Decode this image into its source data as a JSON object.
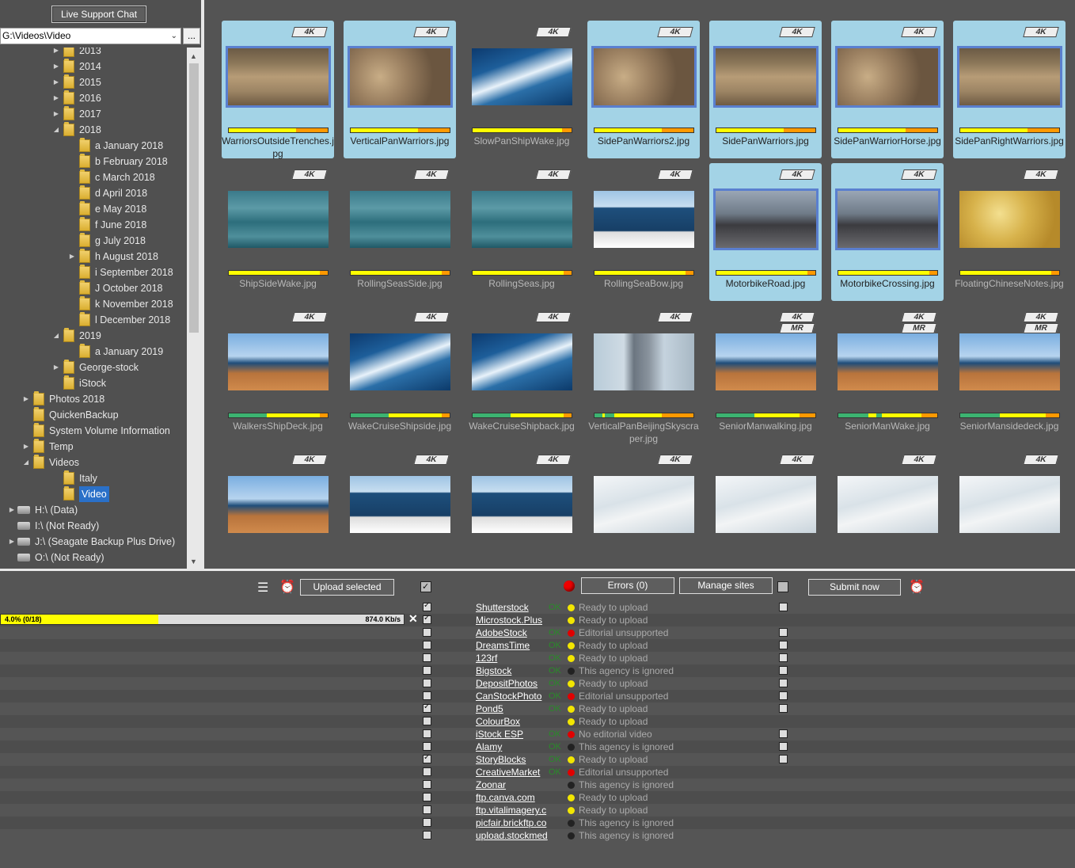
{
  "top": {
    "chat_label": "Live Support Chat",
    "path_value": "G:\\Videos\\Video",
    "browse_label": "..."
  },
  "tree": [
    {
      "label": "2013",
      "depth": 3,
      "arrow": "right",
      "icon": "folder"
    },
    {
      "label": "2014",
      "depth": 3,
      "arrow": "right",
      "icon": "folder"
    },
    {
      "label": "2015",
      "depth": 3,
      "arrow": "right",
      "icon": "folder"
    },
    {
      "label": "2016",
      "depth": 3,
      "arrow": "right",
      "icon": "folder"
    },
    {
      "label": "2017",
      "depth": 3,
      "arrow": "right",
      "icon": "folder"
    },
    {
      "label": "2018",
      "depth": 3,
      "arrow": "down",
      "icon": "folder"
    },
    {
      "label": "a January 2018",
      "depth": 4,
      "arrow": "",
      "icon": "folder"
    },
    {
      "label": "b February 2018",
      "depth": 4,
      "arrow": "",
      "icon": "folder"
    },
    {
      "label": "c March 2018",
      "depth": 4,
      "arrow": "",
      "icon": "folder"
    },
    {
      "label": "d April 2018",
      "depth": 4,
      "arrow": "",
      "icon": "folder"
    },
    {
      "label": "e May 2018",
      "depth": 4,
      "arrow": "",
      "icon": "folder"
    },
    {
      "label": "f June 2018",
      "depth": 4,
      "arrow": "",
      "icon": "folder"
    },
    {
      "label": "g July 2018",
      "depth": 4,
      "arrow": "",
      "icon": "folder"
    },
    {
      "label": "h August 2018",
      "depth": 4,
      "arrow": "right",
      "icon": "folder"
    },
    {
      "label": "i September 2018",
      "depth": 4,
      "arrow": "",
      "icon": "folder"
    },
    {
      "label": "J October 2018",
      "depth": 4,
      "arrow": "",
      "icon": "folder"
    },
    {
      "label": "k November 2018",
      "depth": 4,
      "arrow": "",
      "icon": "folder"
    },
    {
      "label": "l December 2018",
      "depth": 4,
      "arrow": "",
      "icon": "folder"
    },
    {
      "label": "2019",
      "depth": 3,
      "arrow": "down",
      "icon": "folder"
    },
    {
      "label": "a January 2019",
      "depth": 4,
      "arrow": "",
      "icon": "folder"
    },
    {
      "label": "George-stock",
      "depth": 3,
      "arrow": "right",
      "icon": "folder"
    },
    {
      "label": "iStock",
      "depth": 3,
      "arrow": "",
      "icon": "folder"
    },
    {
      "label": "Photos 2018",
      "depth": 2,
      "arrow": "right",
      "icon": "folder"
    },
    {
      "label": "QuickenBackup",
      "depth": 2,
      "arrow": "",
      "icon": "folder"
    },
    {
      "label": "System Volume Information",
      "depth": 2,
      "arrow": "",
      "icon": "folder"
    },
    {
      "label": "Temp",
      "depth": 2,
      "arrow": "right",
      "icon": "folder"
    },
    {
      "label": "Videos",
      "depth": 2,
      "arrow": "down",
      "icon": "folder"
    },
    {
      "label": "Italy",
      "depth": 3,
      "arrow": "",
      "icon": "folder"
    },
    {
      "label": "Video",
      "depth": 3,
      "arrow": "",
      "icon": "folder",
      "selected": true
    },
    {
      "label": "H:\\ (Data)",
      "depth": 1,
      "arrow": "right",
      "icon": "drive"
    },
    {
      "label": "I:\\ (Not Ready)",
      "depth": 1,
      "arrow": "",
      "icon": "drive"
    },
    {
      "label": "J:\\ (Seagate Backup Plus Drive)",
      "depth": 1,
      "arrow": "right",
      "icon": "drive"
    },
    {
      "label": "O:\\ (Not Ready)",
      "depth": 1,
      "arrow": "",
      "icon": "drive"
    }
  ],
  "thumbnails": [
    {
      "name": "WarriorsOutsideTrenches.jpg",
      "selected": true,
      "badges": [
        "4K"
      ],
      "scene": "warriors1",
      "bar": [
        [
          "#ffff00",
          68
        ],
        [
          "#ff9900",
          32
        ]
      ]
    },
    {
      "name": "VerticalPanWarriors.jpg",
      "selected": true,
      "badges": [
        "4K"
      ],
      "scene": "warriors2",
      "bar": [
        [
          "#ffff00",
          68
        ],
        [
          "#ff9900",
          32
        ]
      ]
    },
    {
      "name": "SlowPanShipWake.jpg",
      "selected": false,
      "badges": [
        "4K"
      ],
      "scene": "wake",
      "bar": [
        [
          "#ffff00",
          90
        ],
        [
          "#ff9900",
          10
        ]
      ]
    },
    {
      "name": "SidePanWarriors2.jpg",
      "selected": true,
      "badges": [
        "4K"
      ],
      "scene": "warriors2",
      "bar": [
        [
          "#ffff00",
          68
        ],
        [
          "#ff9900",
          32
        ]
      ]
    },
    {
      "name": "SidePanWarriors.jpg",
      "selected": true,
      "badges": [
        "4K"
      ],
      "scene": "warriors1",
      "bar": [
        [
          "#ffff00",
          68
        ],
        [
          "#ff9900",
          32
        ]
      ]
    },
    {
      "name": "SidePanWarriorHorse.jpg",
      "selected": true,
      "badges": [
        "4K"
      ],
      "scene": "warriors2",
      "bar": [
        [
          "#ffff00",
          68
        ],
        [
          "#ff9900",
          32
        ]
      ]
    },
    {
      "name": "SidePanRightWarriors.jpg",
      "selected": true,
      "badges": [
        "4K"
      ],
      "scene": "warriors1",
      "bar": [
        [
          "#ffff00",
          68
        ],
        [
          "#ff9900",
          32
        ]
      ]
    },
    {
      "name": "ShipSideWake.jpg",
      "selected": false,
      "badges": [
        "4K"
      ],
      "scene": "sea",
      "bar": [
        [
          "#ffff00",
          92
        ],
        [
          "#ff9900",
          8
        ]
      ]
    },
    {
      "name": "RollingSeasSide.jpg",
      "selected": false,
      "badges": [
        "4K"
      ],
      "scene": "sea",
      "bar": [
        [
          "#ffff00",
          92
        ],
        [
          "#ff9900",
          8
        ]
      ]
    },
    {
      "name": "RollingSeas.jpg",
      "selected": false,
      "badges": [
        "4K"
      ],
      "scene": "sea",
      "bar": [
        [
          "#ffff00",
          92
        ],
        [
          "#ff9900",
          8
        ]
      ]
    },
    {
      "name": "RollingSeaBow.jpg",
      "selected": false,
      "badges": [
        "4K"
      ],
      "scene": "bow",
      "bar": [
        [
          "#ffff00",
          92
        ],
        [
          "#ff9900",
          8
        ]
      ]
    },
    {
      "name": "MotorbikeRoad.jpg",
      "selected": true,
      "badges": [
        "4K"
      ],
      "scene": "street",
      "bar": [
        [
          "#ffff00",
          92
        ],
        [
          "#ff9900",
          8
        ]
      ]
    },
    {
      "name": "MotorbikeCrossing.jpg",
      "selected": true,
      "badges": [
        "4K"
      ],
      "scene": "street",
      "bar": [
        [
          "#ffff00",
          92
        ],
        [
          "#ff9900",
          8
        ]
      ]
    },
    {
      "name": "FloatingChineseNotes.jpg",
      "selected": false,
      "badges": [
        "4K"
      ],
      "scene": "notes",
      "bar": [
        [
          "#ffff00",
          92
        ],
        [
          "#ff9900",
          8
        ]
      ]
    },
    {
      "name": "WalkersShipDeck.jpg",
      "selected": false,
      "badges": [
        "4K"
      ],
      "scene": "deck",
      "bar": [
        [
          "#3cb371",
          38
        ],
        [
          "#ffff00",
          54
        ],
        [
          "#ff9900",
          8
        ]
      ]
    },
    {
      "name": "WakeCruiseShipside.jpg",
      "selected": false,
      "badges": [
        "4K"
      ],
      "scene": "wake",
      "bar": [
        [
          "#3cb371",
          38
        ],
        [
          "#ffff00",
          54
        ],
        [
          "#ff9900",
          8
        ]
      ]
    },
    {
      "name": "WakeCruiseShipback.jpg",
      "selected": false,
      "badges": [
        "4K"
      ],
      "scene": "wake",
      "bar": [
        [
          "#3cb371",
          38
        ],
        [
          "#ffff00",
          54
        ],
        [
          "#ff9900",
          8
        ]
      ]
    },
    {
      "name": "VerticalPanBeijingSkyscraper.jpg",
      "selected": false,
      "badges": [
        "4K"
      ],
      "scene": "sky",
      "bar": [
        [
          "#3cb371",
          8
        ],
        [
          "#ffff00",
          2
        ],
        [
          "#3cb371",
          10
        ],
        [
          "#ffff00",
          48
        ],
        [
          "#ff9900",
          32
        ]
      ]
    },
    {
      "name": "SeniorManwalking.jpg",
      "selected": false,
      "badges": [
        "4K",
        "MR"
      ],
      "scene": "deck",
      "bar": [
        [
          "#3cb371",
          38
        ],
        [
          "#ffff00",
          46
        ],
        [
          "#ff9900",
          16
        ]
      ]
    },
    {
      "name": "SeniorManWake.jpg",
      "selected": false,
      "badges": [
        "4K",
        "MR"
      ],
      "scene": "deck",
      "bar": [
        [
          "#3cb371",
          30
        ],
        [
          "#ffff00",
          8
        ],
        [
          "#3cb371",
          6
        ],
        [
          "#ffff00",
          40
        ],
        [
          "#ff9900",
          16
        ]
      ]
    },
    {
      "name": "SeniorMansidedeck.jpg",
      "selected": false,
      "badges": [
        "4K",
        "MR"
      ],
      "scene": "deck",
      "bar": [
        [
          "#3cb371",
          40
        ],
        [
          "#ffff00",
          46
        ],
        [
          "#ff9900",
          14
        ]
      ]
    },
    {
      "name": "",
      "selected": false,
      "badges": [
        "4K"
      ],
      "scene": "deck",
      "bar": null
    },
    {
      "name": "",
      "selected": false,
      "badges": [
        "4K"
      ],
      "scene": "bow",
      "bar": null
    },
    {
      "name": "",
      "selected": false,
      "badges": [
        "4K"
      ],
      "scene": "bow",
      "bar": null
    },
    {
      "name": "",
      "selected": false,
      "badges": [
        "4K"
      ],
      "scene": "tax",
      "bar": null
    },
    {
      "name": "",
      "selected": false,
      "badges": [
        "4K"
      ],
      "scene": "tax",
      "bar": null
    },
    {
      "name": "",
      "selected": false,
      "badges": [
        "4K"
      ],
      "scene": "tax",
      "bar": null
    },
    {
      "name": "",
      "selected": false,
      "badges": [
        "4K"
      ],
      "scene": "tax",
      "bar": null
    }
  ],
  "toolbar": {
    "upload_selected": "Upload selected",
    "errors": "Errors (0)",
    "manage_sites": "Manage sites",
    "submit_now": "Submit now"
  },
  "progress": {
    "left_text": "4.0% (0/18)",
    "right_text": "874.0 Kb/s",
    "fraction": 0.04
  },
  "sites": [
    {
      "name": "Shutterstock",
      "checked": true,
      "ok": "OK",
      "dot": "yellow",
      "status": "Ready to upload",
      "right": true
    },
    {
      "name": "Microstock.Plus",
      "checked": true,
      "ok": "",
      "dot": "yellow",
      "status": "Ready to upload",
      "right": false
    },
    {
      "name": "AdobeStock",
      "checked": false,
      "ok": "OK",
      "dot": "red",
      "status": "Editorial unsupported",
      "right": true
    },
    {
      "name": "DreamsTime",
      "checked": false,
      "ok": "OK",
      "dot": "yellow",
      "status": "Ready to upload",
      "right": true
    },
    {
      "name": "123rf",
      "checked": false,
      "ok": "OK",
      "dot": "yellow",
      "status": "Ready to upload",
      "right": true
    },
    {
      "name": "Bigstock",
      "checked": false,
      "ok": "OK",
      "dot": "black",
      "status": "This agency is ignored",
      "right": true
    },
    {
      "name": "DepositPhotos",
      "checked": false,
      "ok": "OK",
      "dot": "yellow",
      "status": "Ready to upload",
      "right": true
    },
    {
      "name": "CanStockPhoto",
      "checked": false,
      "ok": "OK",
      "dot": "red",
      "status": "Editorial unsupported",
      "right": true
    },
    {
      "name": "Pond5",
      "checked": true,
      "ok": "OK",
      "dot": "yellow",
      "status": "Ready to upload",
      "right": true
    },
    {
      "name": "ColourBox",
      "checked": false,
      "ok": "",
      "dot": "yellow",
      "status": "Ready to upload",
      "right": false
    },
    {
      "name": "iStock ESP",
      "checked": false,
      "ok": "OK",
      "dot": "red",
      "status": "No editorial video",
      "right": true
    },
    {
      "name": "Alamy",
      "checked": false,
      "ok": "OK",
      "dot": "black",
      "status": "This agency is ignored",
      "right": true
    },
    {
      "name": "StoryBlocks",
      "checked": true,
      "ok": "OK",
      "dot": "yellow",
      "status": "Ready to upload",
      "right": true
    },
    {
      "name": "CreativeMarket",
      "checked": false,
      "ok": "OK",
      "dot": "red",
      "status": "Editorial unsupported",
      "right": false
    },
    {
      "name": "Zoonar",
      "checked": false,
      "ok": "",
      "dot": "black",
      "status": "This agency is ignored",
      "right": false
    },
    {
      "name": "ftp.canva.com",
      "checked": false,
      "ok": "",
      "dot": "yellow",
      "status": "Ready to upload",
      "right": false
    },
    {
      "name": "ftp.vitalimagery.c",
      "checked": false,
      "ok": "",
      "dot": "yellow",
      "status": "Ready to upload",
      "right": false
    },
    {
      "name": "picfair.brickftp.co",
      "checked": false,
      "ok": "",
      "dot": "black",
      "status": "This agency is ignored",
      "right": false
    },
    {
      "name": "upload.stockmed",
      "checked": false,
      "ok": "",
      "dot": "black",
      "status": "This agency is ignored",
      "right": false
    }
  ],
  "colors": {
    "yellow": "#f2e600",
    "red": "#e00000",
    "black": "#222222",
    "selected_bg": "#a3d3e6",
    "accent": "#2a70c8"
  }
}
